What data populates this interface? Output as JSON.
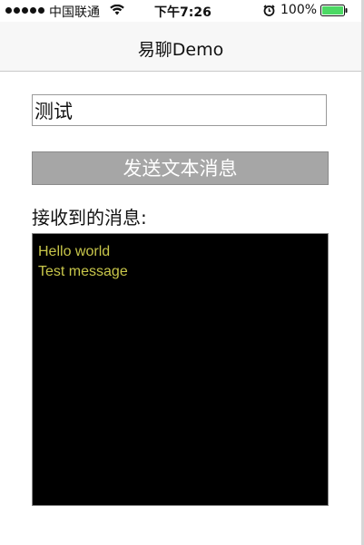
{
  "status_bar": {
    "carrier": "中国联通",
    "time": "下午7:26",
    "battery_percent": "100%",
    "signal_bars": 5,
    "battery_level": 1.0,
    "battery_color": "#4cd964"
  },
  "nav": {
    "title": "易聊Demo"
  },
  "input": {
    "value": "测试"
  },
  "send_button": {
    "label": "发送文本消息"
  },
  "received": {
    "label": "接收到的消息:",
    "messages": [
      "Hello world",
      "Test message"
    ],
    "text_color": "#c8c64a",
    "background": "#000000"
  },
  "icons": {
    "wifi": "wifi-icon",
    "alarm": "alarm-icon",
    "battery": "battery-icon"
  }
}
